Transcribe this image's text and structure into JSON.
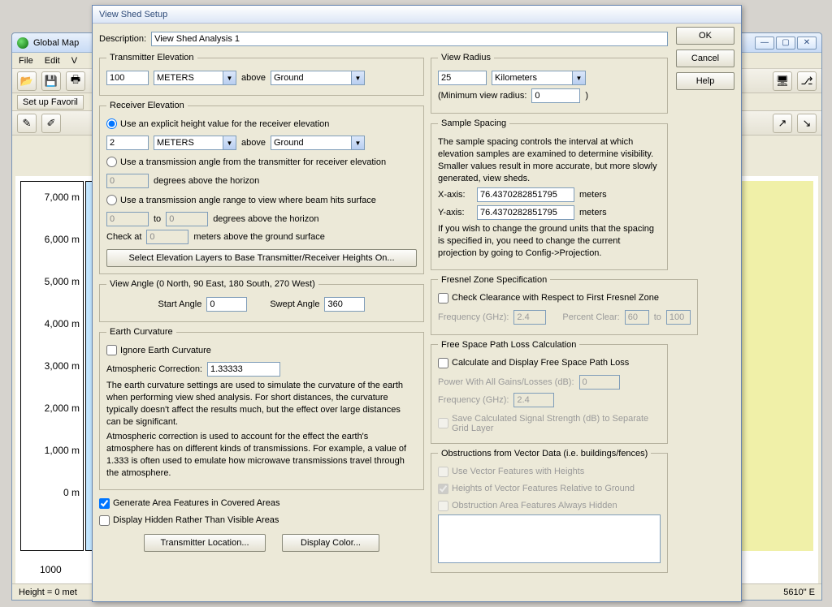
{
  "mainwin": {
    "title": "Global Map",
    "menu": [
      "File",
      "Edit",
      "V"
    ],
    "favorites_btn": "Set up Favoril",
    "status_left": "Height = 0 met",
    "status_right": "5610\" E",
    "yaxis_ticks": [
      "7,000 m",
      "6,000 m",
      "5,000 m",
      "4,000 m",
      "3,000 m",
      "2,000 m",
      "1,000 m",
      "0 m"
    ],
    "scalebar": "1000"
  },
  "dialog": {
    "title": "View Shed Setup",
    "ok": "OK",
    "cancel": "Cancel",
    "help": "Help",
    "desc_label": "Description:",
    "desc_value": "View Shed Analysis 1",
    "tx": {
      "legend": "Transmitter Elevation",
      "value": "100",
      "unit": "METERS",
      "above": "above",
      "ref": "Ground"
    },
    "rx": {
      "legend": "Receiver Elevation",
      "r1": "Use an explicit height value for the receiver elevation",
      "value": "2",
      "unit": "METERS",
      "above": "above",
      "ref": "Ground",
      "r2": "Use a transmission angle from the transmitter for receiver elevation",
      "angle1": "0",
      "deg_above": "degrees above the horizon",
      "r3": "Use a transmission angle range to view where beam hits surface",
      "to": "to",
      "angle2a": "0",
      "angle2b": "0",
      "check_at": "Check at",
      "check_val": "0",
      "check_tail": "meters above the ground surface",
      "select_btn": "Select Elevation Layers to Base Transmitter/Receiver Heights On..."
    },
    "angle": {
      "legend": "View Angle (0 North, 90 East, 180 South, 270 West)",
      "start_lbl": "Start Angle",
      "start_val": "0",
      "swept_lbl": "Swept Angle",
      "swept_val": "360"
    },
    "curv": {
      "legend": "Earth Curvature",
      "ignore": "Ignore Earth Curvature",
      "atm_lbl": "Atmospheric Correction:",
      "atm_val": "1.33333",
      "p1": "The earth curvature settings are used to simulate the curvature of the earth when performing view shed analysis. For short distances, the curvature typically doesn't affect the results much, but the effect over large distances can be significant.",
      "p2": "Atmospheric correction is used to account for the effect the earth's atmosphere has on different kinds of transmissions. For example, a value of 1.333 is often used to emulate how microwave transmissions travel through the atmosphere."
    },
    "gen_area": "Generate Area Features in Covered Areas",
    "disp_hidden": "Display Hidden Rather Than Visible Areas",
    "tx_loc_btn": "Transmitter Location...",
    "disp_color_btn": "Display Color...",
    "radius": {
      "legend": "View Radius",
      "value": "25",
      "unit": "Kilometers",
      "min_lbl": "(Minimum view radius:",
      "min_val": "0",
      "min_tail": ")"
    },
    "spacing": {
      "legend": "Sample Spacing",
      "desc": "The sample spacing controls the interval at which elevation samples are examined to determine visibility. Smaller values result in more accurate, but more slowly generated, view sheds.",
      "x_lbl": "X-axis:",
      "x_val": "76.4370282851795",
      "x_unit": "meters",
      "y_lbl": "Y-axis:",
      "y_val": "76.4370282851795",
      "y_unit": "meters",
      "note": "If you wish to change the ground units that the spacing is specified in, you need to change the current projection by going to Config->Projection."
    },
    "fresnel": {
      "legend": "Fresnel Zone Specification",
      "check": "Check Clearance with Respect to First Fresnel Zone",
      "freq_lbl": "Frequency (GHz):",
      "freq_val": "2.4",
      "pct_lbl": "Percent Clear:",
      "pct1": "60",
      "pct_to": "to",
      "pct2": "100"
    },
    "fspl": {
      "legend": "Free Space Path Loss Calculation",
      "check": "Calculate and Display Free Space Path Loss",
      "power_lbl": "Power With All Gains/Losses (dB):",
      "power_val": "0",
      "freq_lbl": "Frequency (GHz):",
      "freq_val": "2.4",
      "save": "Save Calculated Signal Strength (dB) to Separate Grid Layer"
    },
    "obs": {
      "legend": "Obstructions from Vector Data (i.e. buildings/fences)",
      "c1": "Use Vector Features with Heights",
      "c2": "Heights of Vector Features Relative to Ground",
      "c3": "Obstruction Area Features Always Hidden"
    }
  }
}
